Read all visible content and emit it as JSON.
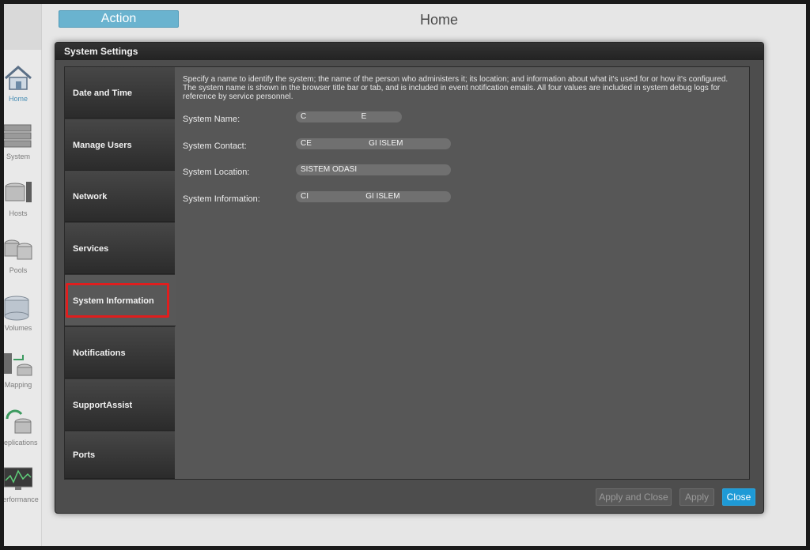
{
  "topbar": {
    "action_label": "Action",
    "page_title": "Home"
  },
  "nav": {
    "items": [
      {
        "label": "Home",
        "icon": "house-icon"
      },
      {
        "label": "System",
        "icon": "server-rack-icon"
      },
      {
        "label": "Hosts",
        "icon": "hosts-icon"
      },
      {
        "label": "Pools",
        "icon": "pools-icon"
      },
      {
        "label": "Volumes",
        "icon": "volumes-icon"
      },
      {
        "label": "Mapping",
        "icon": "mapping-icon"
      },
      {
        "label": "Replications",
        "icon": "replications-icon"
      },
      {
        "label": "Performance",
        "icon": "performance-icon"
      }
    ]
  },
  "modal": {
    "title": "System Settings",
    "tabs": [
      {
        "label": "Date and Time"
      },
      {
        "label": "Manage Users"
      },
      {
        "label": "Network"
      },
      {
        "label": "Services"
      },
      {
        "label": "System Information"
      },
      {
        "label": "Notifications"
      },
      {
        "label": "SupportAssist"
      },
      {
        "label": "Ports"
      }
    ],
    "active_tab": "System Information",
    "description": "Specify a name to identify the system; the name of the person who administers it; its location; and information about what it's used for or how it's configured. The system name is shown in the browser title bar or tab, and is included in event notification emails. All four values are included in system debug logs for reference by service personnel.",
    "fields": {
      "system_name": {
        "label": "System Name:",
        "value": "C                         E"
      },
      "system_contact": {
        "label": "System Contact:",
        "value": "CE                          GI ISLEM"
      },
      "system_location": {
        "label": "System Location:",
        "value": "SISTEM ODASI"
      },
      "system_information": {
        "label": "System Information:",
        "value": "CI                          GI ISLEM"
      }
    },
    "buttons": {
      "apply_and_close": "Apply and Close",
      "apply": "Apply",
      "close": "Close"
    }
  },
  "colors": {
    "accent": "#1e9ad6",
    "action": "#6ab3cf",
    "highlight": "#e01e1e"
  }
}
